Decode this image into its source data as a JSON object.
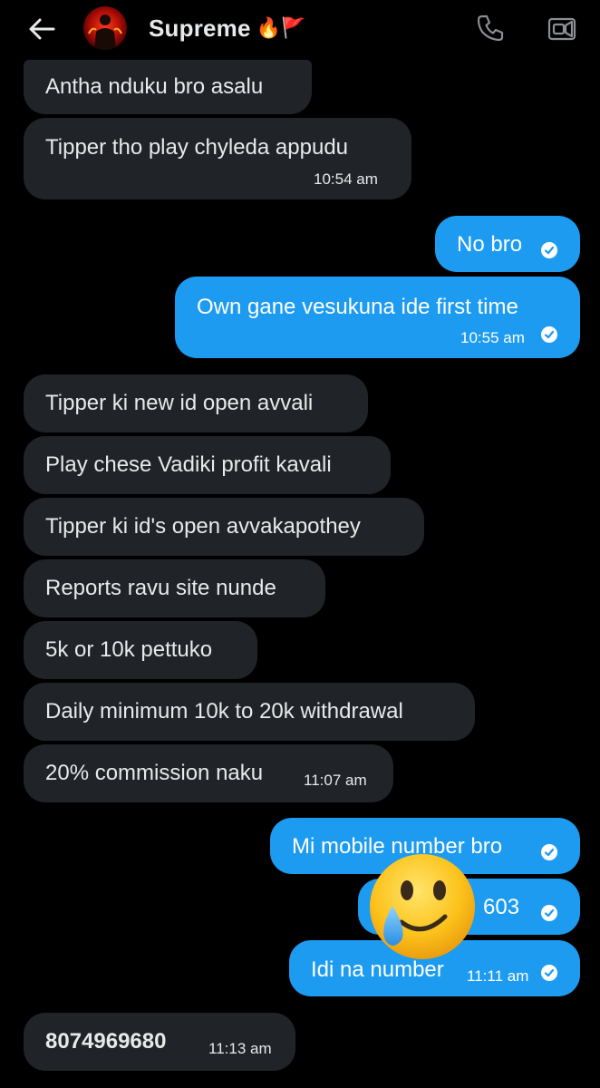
{
  "header": {
    "contact_name": "Supreme",
    "name_emoji": "🔥🚩",
    "icons": {
      "back": "back-arrow-icon",
      "call": "phone-icon",
      "video": "video-call-icon"
    }
  },
  "messages": [
    {
      "dir": "received",
      "text": "Antha nduku bro asalu",
      "time": ""
    },
    {
      "dir": "received",
      "text": "Tipper tho play chyleda appudu",
      "time": "10:54 am"
    },
    {
      "dir": "sent",
      "text": "No bro",
      "time": ""
    },
    {
      "dir": "sent",
      "text": "Own gane vesukuna ide first time",
      "time": "10:55 am"
    },
    {
      "dir": "received",
      "text": "Tipper ki new id open avvali",
      "time": ""
    },
    {
      "dir": "received",
      "text": "Play chese Vadiki profit kavali",
      "time": ""
    },
    {
      "dir": "received",
      "text": "Tipper ki id's open avvakapothey",
      "time": ""
    },
    {
      "dir": "received",
      "text": "Reports ravu site nunde",
      "time": ""
    },
    {
      "dir": "received",
      "text": "5k or 10k pettuko",
      "time": ""
    },
    {
      "dir": "received",
      "text": "Daily minimum 10k to 20k withdrawal",
      "time": ""
    },
    {
      "dir": "received",
      "text": "20% commission naku",
      "time": "11:07 am"
    },
    {
      "dir": "sent",
      "text": "Mi mobile number bro",
      "time": ""
    },
    {
      "dir": "sent",
      "text": "603",
      "time": ""
    },
    {
      "dir": "sent",
      "text": "Idi na number",
      "time": "11:11 am"
    },
    {
      "dir": "received",
      "text": "8074969680",
      "time": "11:13 am"
    }
  ],
  "overlay": {
    "icon": "smiling-face-with-tear-icon"
  },
  "colors": {
    "background": "#000000",
    "received_bubble": "#202327",
    "sent_bubble": "#1d9bf0",
    "text": "#e7e9ea"
  }
}
